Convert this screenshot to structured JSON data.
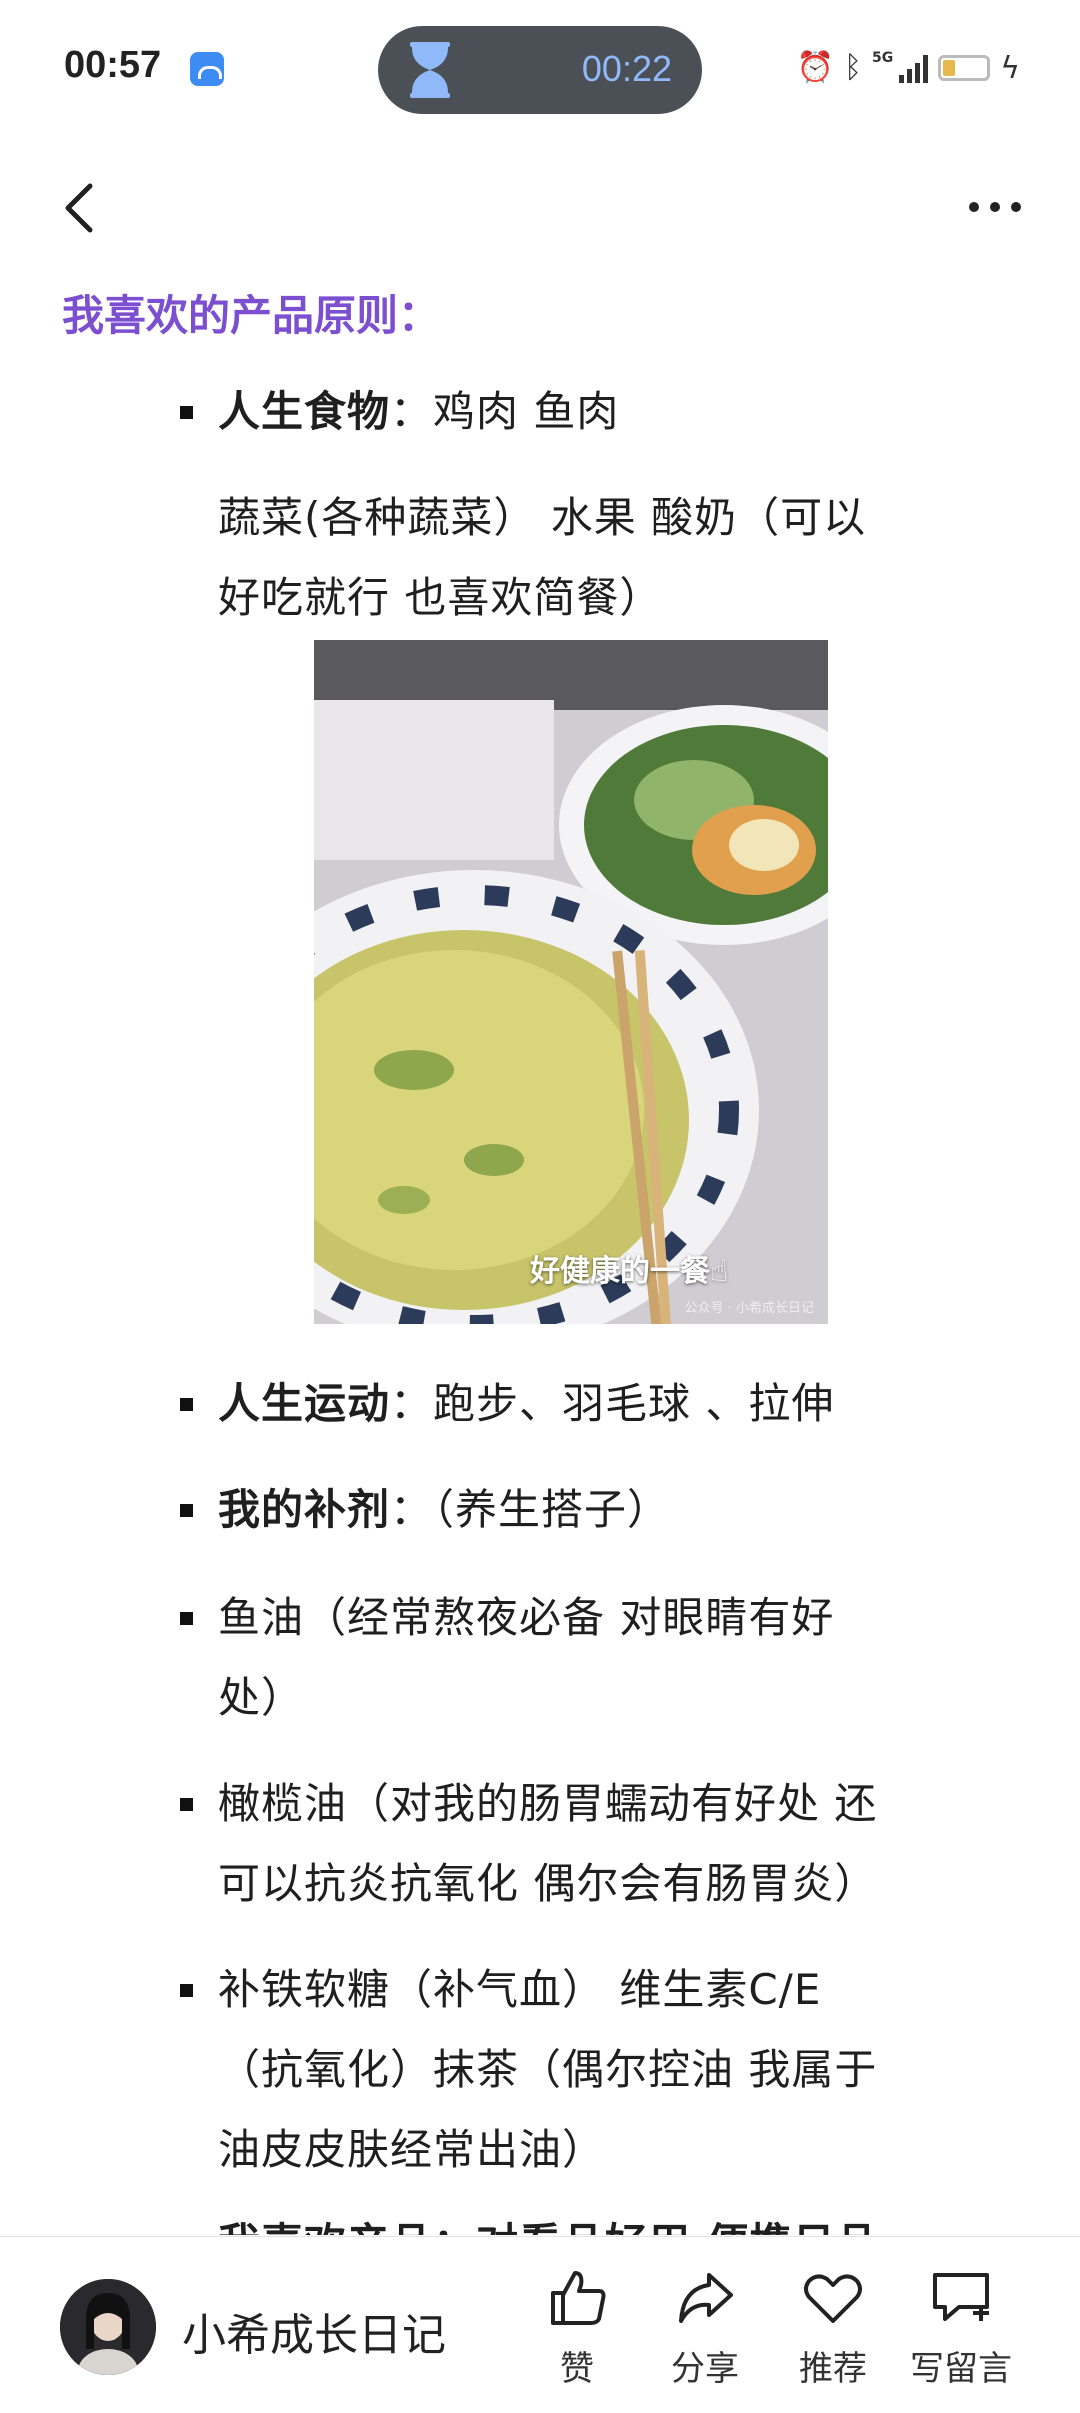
{
  "status_bar": {
    "time": "00:57",
    "pill_time": "00:22",
    "network": "5G",
    "battery": "9"
  },
  "article": {
    "heading": "我喜欢的产品原则：",
    "food_label": "人生食物",
    "food_value": "：鸡肉 鱼肉",
    "food_line2": "蔬菜(各种蔬菜） 水果 酸奶（可以",
    "food_line3": "好吃就行 也喜欢简餐）",
    "photo_caption": "好健康的一餐☝",
    "photo_watermark": "公众号 · 小希成长日记",
    "sport_label": "人生运动",
    "sport_value": "：跑步、羽毛球 、拉伸",
    "supp_label": "我的补剂",
    "supp_value": "：（养生搭子）",
    "fish_oil_1": "鱼油（经常熬夜必备 对眼睛有好",
    "fish_oil_2": "处）",
    "olive_1": "橄榄油（对我的肠胃蠕动有好处 还",
    "olive_2": "可以抗炎抗氧化 偶尔会有肠胃炎）",
    "iron_1": "补铁软糖（补气血） 维生素C/E",
    "iron_2": "（抗氧化）抹茶（偶尔控油 我属于",
    "iron_3": "油皮皮肤经常出油）",
    "cut_line": "我喜欢产品：对看品好用 便携日品"
  },
  "bottom_bar": {
    "author": "小希成长日记",
    "like": "赞",
    "share": "分享",
    "recommend": "推荐",
    "comment": "写留言"
  },
  "colors": {
    "heading": "#7c4fd0",
    "pill_bg": "#4b4f56",
    "pill_text": "#8fb9f8"
  }
}
